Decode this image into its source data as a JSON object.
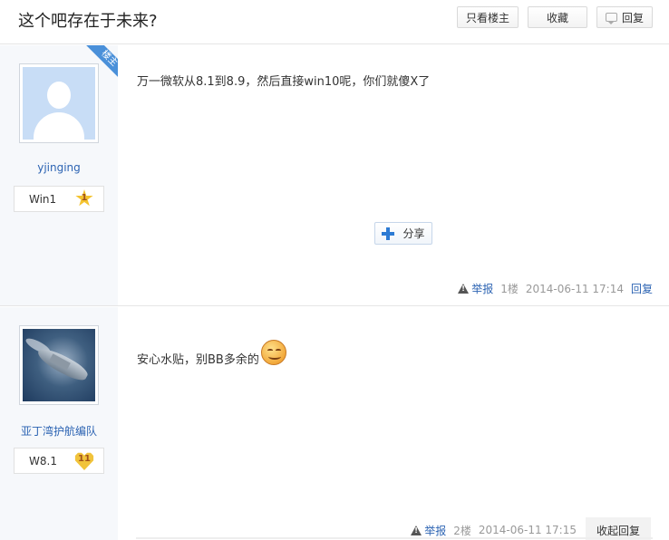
{
  "header": {
    "title": "这个吧存在于未来?",
    "only_author": "只看楼主",
    "favorite": "收藏",
    "reply": "回复"
  },
  "posts": [
    {
      "username": "yjinging",
      "level_name": "Win1",
      "level_num": "1",
      "author_tag": "楼主",
      "content": "万一微软从8.1到8.9，然后直接win10呢，你们就傻X了",
      "share": "分享",
      "report": "举报",
      "floor": "1楼",
      "time": "2014-06-11 17:14",
      "reply": "回复"
    },
    {
      "username": "亚丁湾护航编队",
      "level_name": "W8.1",
      "level_num": "11",
      "content": "安心水贴，别BB多余的",
      "report": "举报",
      "floor": "2楼",
      "time": "2014-06-11 17:15",
      "collapse": "收起回复"
    }
  ],
  "colors": {
    "link": "#2d64b3",
    "sidebar_bg": "#f6f8fb",
    "ribbon": "#4a90d9"
  }
}
